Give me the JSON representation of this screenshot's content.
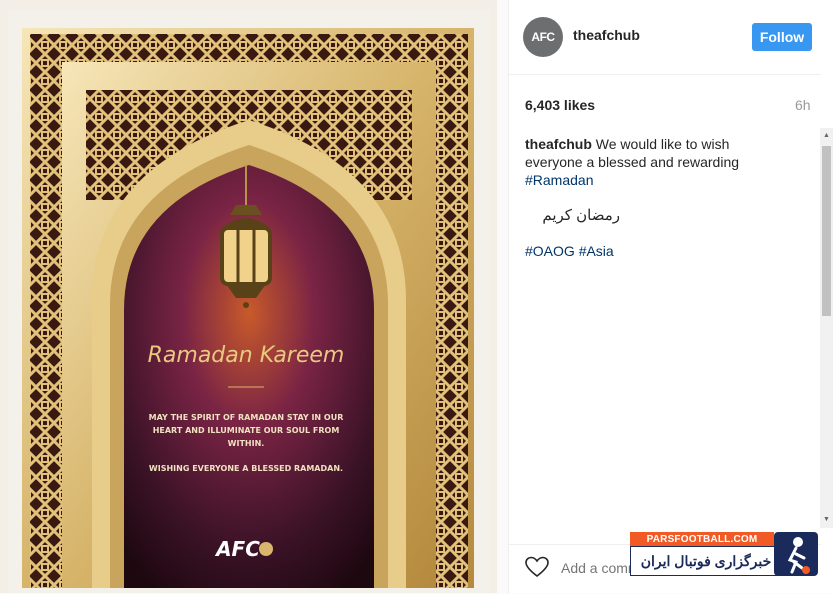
{
  "post_image": {
    "greeting": "Ramadan Kareem",
    "message_lines": [
      "MAY THE SPIRIT OF RAMADAN STAY IN OUR",
      "HEART AND ILLUMINATE OUR SOUL FROM",
      "WITHIN."
    ],
    "wish": "WISHING EVERYONE A BLESSED RAMADAN.",
    "logo_text": "AFC",
    "colors": {
      "gold": "#c9a45c",
      "gold_light": "#f3dc9e",
      "purple": "#6b1f3f",
      "dark": "#2a0d18"
    }
  },
  "header": {
    "avatar_text": "AFC",
    "username": "theafchub",
    "follow_label": "Follow"
  },
  "stats": {
    "likes": "6,403 likes",
    "time": "6h"
  },
  "caption": {
    "username": "theafchub",
    "text": "We would like to wish everyone a blessed and rewarding",
    "hashtag": "#Ramadan",
    "arabic": "رمضان كريم",
    "tag1": "#OAOG",
    "tag2": "#Asia"
  },
  "comment": {
    "placeholder": "Add a comment…"
  },
  "watermark": {
    "site": "PARSFOOTBALL.COM",
    "tagline": "خبرگزاری فوتبال ایران"
  }
}
